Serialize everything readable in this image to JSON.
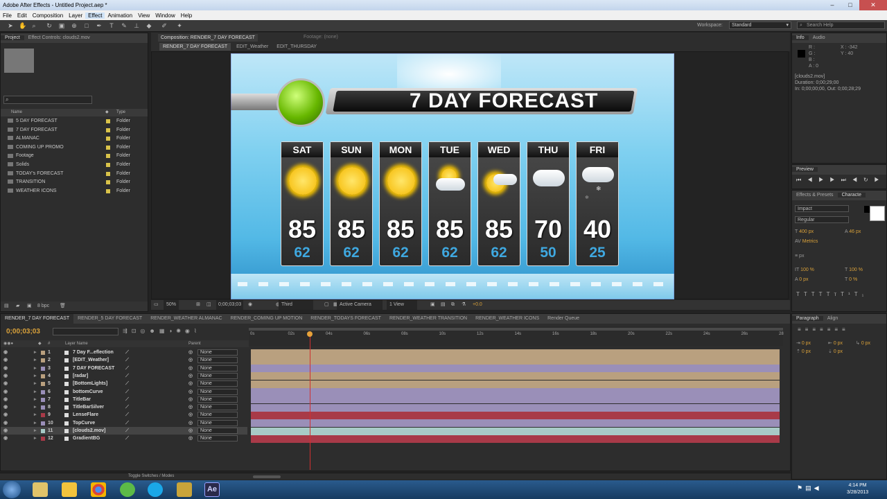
{
  "window": {
    "title": "Adobe After Effects - Untitled Project.aep *",
    "min": "–",
    "max": "□",
    "close": "✕"
  },
  "menu": [
    "File",
    "Edit",
    "Composition",
    "Layer",
    "Effect",
    "Animation",
    "View",
    "Window",
    "Help"
  ],
  "toolbar": {
    "workspace_label": "Workspace:",
    "workspace_value": "Standard",
    "search_placeholder": "Search Help"
  },
  "project": {
    "tabs": [
      "Project",
      "Effect Controls: clouds2.mov"
    ],
    "col_name": "Name",
    "col_type": "Type",
    "items": [
      {
        "name": "5 DAY FORECAST",
        "type": "Folder"
      },
      {
        "name": "7 DAY FORECAST",
        "type": "Folder"
      },
      {
        "name": "ALMANAC",
        "type": "Folder"
      },
      {
        "name": "COMING UP PROMO",
        "type": "Folder"
      },
      {
        "name": "Footage",
        "type": "Folder"
      },
      {
        "name": "Solids",
        "type": "Folder"
      },
      {
        "name": "TODAY's FORECAST",
        "type": "Folder"
      },
      {
        "name": "TRANSITION",
        "type": "Folder"
      },
      {
        "name": "WEATHER ICONS",
        "type": "Folder"
      }
    ],
    "bpc": "8 bpc"
  },
  "comp": {
    "tab": "Composition: RENDER_7 DAY FORECAST",
    "footage_tab": "Footage: (none)",
    "breadcrumbs": [
      "RENDER_7 DAY FORECAST",
      "EDIT_Weather",
      "EDIT_THURSDAY"
    ],
    "zoom": "50%",
    "timecode": "0;00;03;03",
    "res": "Third",
    "camera": "Active Camera",
    "views": "1 View",
    "exposure": "+0.0",
    "banner_title": "7 DAY FORECAST",
    "days": [
      {
        "day": "SAT",
        "hi": "85",
        "lo": "62",
        "icon": "sun"
      },
      {
        "day": "SUN",
        "hi": "85",
        "lo": "62",
        "icon": "sun"
      },
      {
        "day": "MON",
        "hi": "85",
        "lo": "62",
        "icon": "sun"
      },
      {
        "day": "TUE",
        "hi": "85",
        "lo": "62",
        "icon": "partly-cloudy"
      },
      {
        "day": "WED",
        "hi": "85",
        "lo": "62",
        "icon": "partly-cloudy"
      },
      {
        "day": "THU",
        "hi": "70",
        "lo": "50",
        "icon": "cloudy"
      },
      {
        "day": "FRI",
        "hi": "40",
        "lo": "25",
        "icon": "snow"
      }
    ]
  },
  "info": {
    "tabs": [
      "Info",
      "Audio"
    ],
    "rgb": [
      "R :",
      "G :",
      "B :",
      "A : 0"
    ],
    "x": "X : -342",
    "y": "Y : 40",
    "file": "[clouds2.mov]",
    "duration": "Duration: 0;00;29;00",
    "inout": "In: 0;00;00;00, Out: 0;00;28;29"
  },
  "preview": {
    "tab": "Preview"
  },
  "character": {
    "tabs": [
      "Effects & Presets",
      "Characte"
    ],
    "font": "Impact",
    "style": "Regular",
    "size": "400 px",
    "leading": "46 px",
    "tracking": "Metrics",
    "px": "px",
    "pct1": "100 %",
    "pct2": "100 %",
    "px2": "0 px",
    "pct3": "0 %"
  },
  "paragraph": {
    "tabs": [
      "Paragraph",
      "Align"
    ],
    "v1": "0 px",
    "v2": "0 px",
    "v3": "0 px",
    "v4": "0 px",
    "v5": "0 px"
  },
  "timeline": {
    "tabs": [
      "RENDER_7 DAY FORECAST",
      "RENDER_5 DAY FORECAST",
      "RENDER_WEATHER ALMANAC",
      "RENDER_COMING UP MOTION",
      "RENDER_TODAYS FORECAST",
      "RENDER_WEATHER TRANSITION",
      "RENDER_WEATHER ICONS",
      "Render Queue"
    ],
    "timecode": "0;00;03;03",
    "col_layer": "Layer Name",
    "col_parent": "Parent",
    "ruler": [
      "0s",
      "02s",
      "04s",
      "06s",
      "08s",
      "10s",
      "12s",
      "14s",
      "16s",
      "18s",
      "20s",
      "22s",
      "24s",
      "26s",
      "28"
    ],
    "layers": [
      {
        "n": "1",
        "name": "7 Day F...eflection",
        "parent": "None",
        "color": "#b9a07f"
      },
      {
        "n": "2",
        "name": "[EDIT_Weather]",
        "parent": "None",
        "color": "#b9a07f"
      },
      {
        "n": "3",
        "name": "7 DAY FORECAST",
        "parent": "None",
        "color": "#9a8fb8"
      },
      {
        "n": "4",
        "name": "[radar]",
        "parent": "None",
        "color": "#b9a07f"
      },
      {
        "n": "5",
        "name": "[BottomLights]",
        "parent": "None",
        "color": "#b9a07f"
      },
      {
        "n": "6",
        "name": "bottomCurve",
        "parent": "None",
        "color": "#9a8fb8"
      },
      {
        "n": "7",
        "name": "TitleBar",
        "parent": "None",
        "color": "#9a8fb8"
      },
      {
        "n": "8",
        "name": "TitleBarSilver",
        "parent": "None",
        "color": "#9a8fb8"
      },
      {
        "n": "9",
        "name": "LenseFlare",
        "parent": "None",
        "color": "#a83a48"
      },
      {
        "n": "10",
        "name": "TopCurve",
        "parent": "None",
        "color": "#9a8fb8"
      },
      {
        "n": "11",
        "name": "[clouds2.mov]",
        "parent": "None",
        "color": "#a8cbc7"
      },
      {
        "n": "12",
        "name": "GradientBG",
        "parent": "None",
        "color": "#a83a48"
      }
    ],
    "toggle": "Toggle Switches / Modes"
  },
  "taskbar": {
    "time": "4:14 PM",
    "date": "3/28/2013",
    "apps": [
      "Windows Explorer",
      "Libraries",
      "Chrome",
      "Utility",
      "Skype",
      "Plugins",
      "After Effects"
    ]
  }
}
